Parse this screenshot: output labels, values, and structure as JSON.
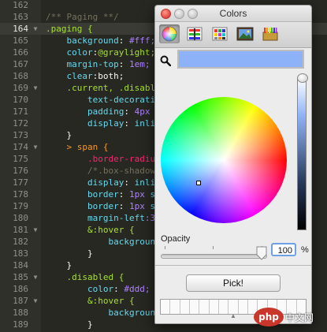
{
  "editor": {
    "lines": [
      {
        "no": "162",
        "fold": "",
        "current": false,
        "tokens": []
      },
      {
        "no": "163",
        "fold": "",
        "current": false,
        "tokens": [
          {
            "t": "/** Paging **/",
            "c": "c-comment"
          }
        ]
      },
      {
        "no": "164",
        "fold": "▼",
        "current": true,
        "tokens": [
          {
            "t": ".paging {",
            "c": "c-sel"
          }
        ]
      },
      {
        "no": "165",
        "fold": "",
        "current": false,
        "tokens": [
          {
            "t": "    background",
            "c": "c-prop"
          },
          {
            "t": ": ",
            "c": "c-plain"
          },
          {
            "t": "#fff;",
            "c": "c-val"
          }
        ]
      },
      {
        "no": "166",
        "fold": "",
        "current": false,
        "tokens": [
          {
            "t": "    color",
            "c": "c-prop"
          },
          {
            "t": ":",
            "c": "c-plain"
          },
          {
            "t": "@graylight;",
            "c": "c-sel"
          }
        ]
      },
      {
        "no": "167",
        "fold": "",
        "current": false,
        "tokens": [
          {
            "t": "    margin-top",
            "c": "c-prop"
          },
          {
            "t": ": ",
            "c": "c-plain"
          },
          {
            "t": "1em;",
            "c": "c-val"
          }
        ]
      },
      {
        "no": "168",
        "fold": "",
        "current": false,
        "tokens": [
          {
            "t": "    clear",
            "c": "c-prop"
          },
          {
            "t": ":both;",
            "c": "c-plain"
          }
        ]
      },
      {
        "no": "169",
        "fold": "▼",
        "current": false,
        "tokens": [
          {
            "t": "    .current, .disable",
            "c": "c-sel"
          }
        ]
      },
      {
        "no": "170",
        "fold": "",
        "current": false,
        "tokens": [
          {
            "t": "        text-decoratio",
            "c": "c-prop"
          }
        ]
      },
      {
        "no": "171",
        "fold": "",
        "current": false,
        "tokens": [
          {
            "t": "        padding",
            "c": "c-prop"
          },
          {
            "t": ": ",
            "c": "c-plain"
          },
          {
            "t": "4px",
            "c": "c-val"
          }
        ]
      },
      {
        "no": "172",
        "fold": "",
        "current": false,
        "tokens": [
          {
            "t": "        display",
            "c": "c-prop"
          },
          {
            "t": ": ",
            "c": "c-plain"
          },
          {
            "t": "inlin",
            "c": "c-prop"
          }
        ]
      },
      {
        "no": "173",
        "fold": "",
        "current": false,
        "tokens": [
          {
            "t": "    }",
            "c": "c-plain"
          }
        ]
      },
      {
        "no": "174",
        "fold": "▼",
        "current": false,
        "tokens": [
          {
            "t": "    > span {",
            "c": "c-warn"
          }
        ]
      },
      {
        "no": "175",
        "fold": "",
        "current": false,
        "tokens": [
          {
            "t": "        .border-radiu",
            "c": "c-sel-ent"
          }
        ]
      },
      {
        "no": "176",
        "fold": "",
        "current": false,
        "tokens": [
          {
            "t": "        /*.box-shadow",
            "c": "c-comment"
          }
        ]
      },
      {
        "no": "177",
        "fold": "",
        "current": false,
        "tokens": [
          {
            "t": "        display",
            "c": "c-prop"
          },
          {
            "t": ": ",
            "c": "c-plain"
          },
          {
            "t": "inli",
            "c": "c-prop"
          }
        ]
      },
      {
        "no": "178",
        "fold": "",
        "current": false,
        "tokens": [
          {
            "t": "        border",
            "c": "c-prop"
          },
          {
            "t": ": ",
            "c": "c-plain"
          },
          {
            "t": "1px",
            "c": "c-val"
          },
          {
            "t": " s",
            "c": "c-prop"
          }
        ]
      },
      {
        "no": "179",
        "fold": "",
        "current": false,
        "tokens": [
          {
            "t": "        border",
            "c": "c-prop"
          },
          {
            "t": ": ",
            "c": "c-plain"
          },
          {
            "t": "1px",
            "c": "c-val"
          },
          {
            "t": " s",
            "c": "c-prop"
          }
        ]
      },
      {
        "no": "180",
        "fold": "",
        "current": false,
        "tokens": [
          {
            "t": "        margin-left",
            "c": "c-prop"
          },
          {
            "t": ":3",
            "c": "c-val"
          }
        ]
      },
      {
        "no": "181",
        "fold": "▼",
        "current": false,
        "tokens": [
          {
            "t": "        &:hover {",
            "c": "c-sel"
          }
        ]
      },
      {
        "no": "182",
        "fold": "",
        "current": false,
        "tokens": [
          {
            "t": "            backgroun",
            "c": "c-prop"
          }
        ]
      },
      {
        "no": "183",
        "fold": "",
        "current": false,
        "tokens": [
          {
            "t": "        }",
            "c": "c-plain"
          }
        ]
      },
      {
        "no": "184",
        "fold": "",
        "current": false,
        "tokens": [
          {
            "t": "    }",
            "c": "c-plain"
          }
        ]
      },
      {
        "no": "185",
        "fold": "▼",
        "current": false,
        "tokens": [
          {
            "t": "    .disabled {",
            "c": "c-sel"
          }
        ]
      },
      {
        "no": "186",
        "fold": "",
        "current": false,
        "tokens": [
          {
            "t": "        color",
            "c": "c-prop"
          },
          {
            "t": ": ",
            "c": "c-plain"
          },
          {
            "t": "#ddd;",
            "c": "c-val"
          }
        ]
      },
      {
        "no": "187",
        "fold": "▼",
        "current": false,
        "tokens": [
          {
            "t": "        &:hover {",
            "c": "c-sel"
          }
        ]
      },
      {
        "no": "188",
        "fold": "",
        "current": false,
        "tokens": [
          {
            "t": "            backgroun",
            "c": "c-prop"
          }
        ]
      },
      {
        "no": "189",
        "fold": "",
        "current": false,
        "tokens": [
          {
            "t": "        }",
            "c": "c-plain"
          }
        ]
      }
    ],
    "overflow_comment": "/"
  },
  "colors_panel": {
    "title": "Colors",
    "toolbar_icons": [
      "color-wheel-icon",
      "color-sliders-icon",
      "color-palettes-icon",
      "image-palettes-icon",
      "crayons-icon"
    ],
    "active_tool": "color-wheel-icon",
    "current_color": "#8db2f8",
    "opacity_label": "Opacity",
    "opacity_value": "100",
    "opacity_unit": "%",
    "opacity_fraction": 1.0,
    "pick_label": "Pick!",
    "swatch_count": 15
  },
  "watermark": {
    "logo_text": "php",
    "site_text": "中文网"
  }
}
